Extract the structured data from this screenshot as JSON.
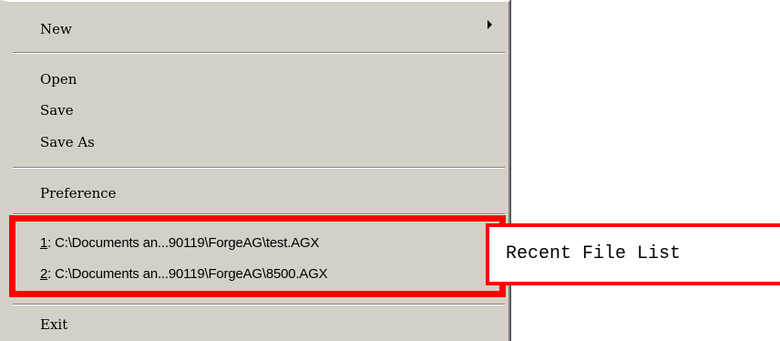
{
  "menu": {
    "items": [
      {
        "label": "New",
        "has_submenu": true
      },
      {
        "label": "Open"
      },
      {
        "label": "Save"
      },
      {
        "label": "Save As"
      },
      {
        "label": "Preference"
      },
      {
        "label": "Exit"
      }
    ],
    "recent_files": [
      {
        "accel": "1",
        "separator": ":",
        "path": "C:\\Documents an...90119\\ForgeAG\\test.AGX"
      },
      {
        "accel": "2",
        "separator": ":",
        "path": "C:\\Documents an...90119\\ForgeAG\\8500.AGX"
      }
    ],
    "submenu_icon": "triangle-right-icon"
  },
  "annotation": {
    "label": "Recent File List",
    "color": "#ff0000"
  },
  "colors": {
    "menu_background": "#d4d0c8",
    "highlight": "#ff0000"
  }
}
